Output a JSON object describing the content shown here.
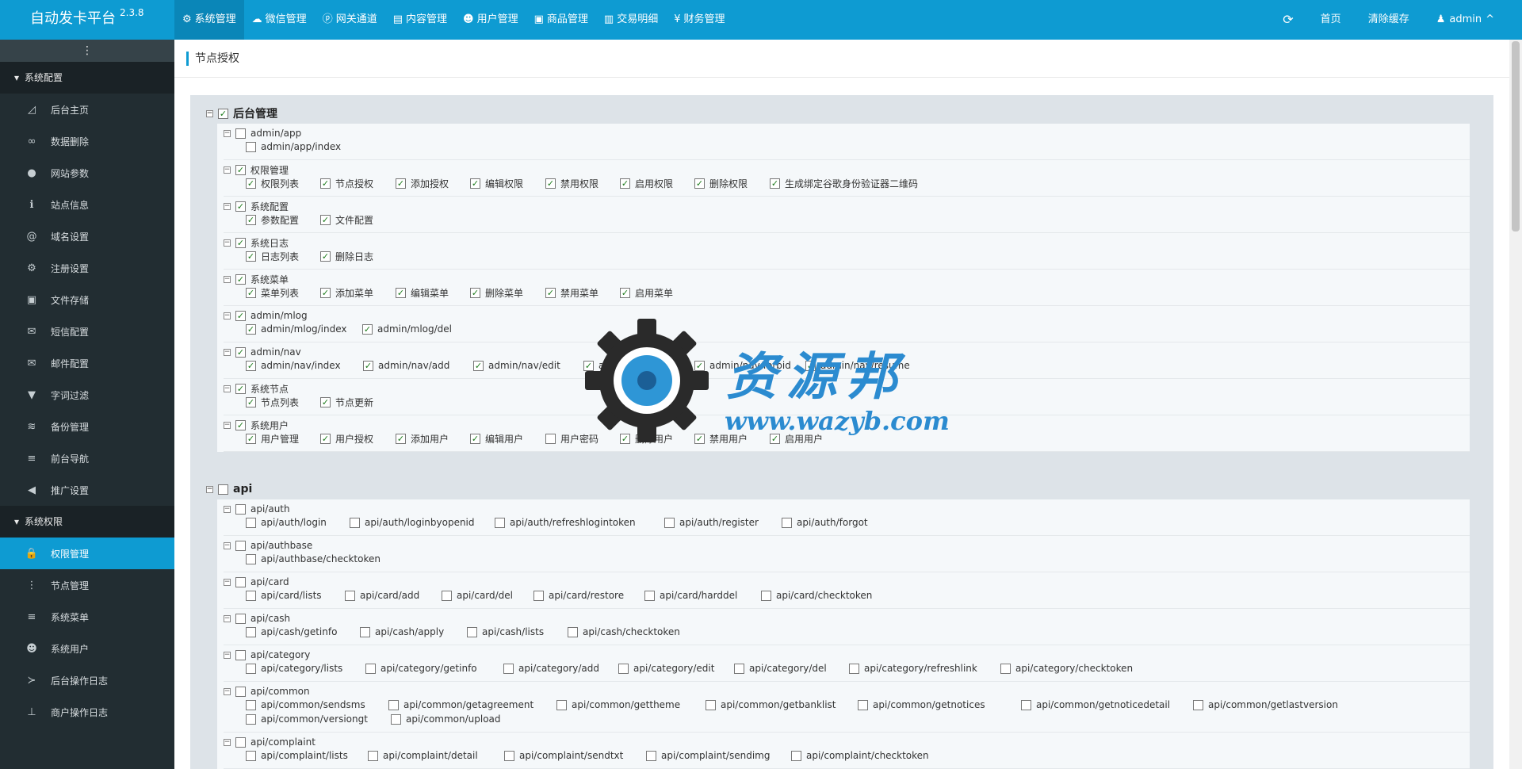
{
  "app": {
    "name": "自动发卡平台",
    "version": "2.3.8"
  },
  "topnav": [
    {
      "label": "系统管理",
      "icon": "gear-icon",
      "glyph": "⚙"
    },
    {
      "label": "微信管理",
      "icon": "wechat-icon",
      "glyph": "☁"
    },
    {
      "label": "网关通道",
      "icon": "gateway-icon",
      "glyph": "ⓟ"
    },
    {
      "label": "内容管理",
      "icon": "document-icon",
      "glyph": "▤"
    },
    {
      "label": "用户管理",
      "icon": "users-icon",
      "glyph": "☻"
    },
    {
      "label": "商品管理",
      "icon": "shopping-bag-icon",
      "glyph": "▣"
    },
    {
      "label": "交易明细",
      "icon": "bar-chart-icon",
      "glyph": "▥"
    },
    {
      "label": "财务管理",
      "icon": "finance-icon",
      "glyph": "¥"
    }
  ],
  "topright": {
    "refresh_glyph": "⟳",
    "home": "首页",
    "clear_cache": "清除缓存",
    "user": "admin",
    "user_glyph": "♟",
    "caret": "^"
  },
  "sidebar": {
    "toggle_glyph": "⋮",
    "groups": [
      {
        "label": "系统配置",
        "caret": "▾"
      },
      {
        "label": "系统权限",
        "caret": "▾"
      }
    ],
    "config_items": [
      {
        "label": "后台主页",
        "icon": "area-chart-icon",
        "glyph": "◿"
      },
      {
        "label": "数据删除",
        "icon": "link-icon",
        "glyph": "∞"
      },
      {
        "label": "网站参数",
        "icon": "apple-icon",
        "glyph": "●"
      },
      {
        "label": "站点信息",
        "icon": "info-icon",
        "glyph": "ℹ"
      },
      {
        "label": "域名设置",
        "icon": "at-icon",
        "glyph": "@"
      },
      {
        "label": "注册设置",
        "icon": "cog-icon",
        "glyph": "⚙"
      },
      {
        "label": "文件存储",
        "icon": "save-icon",
        "glyph": "▣"
      },
      {
        "label": "短信配置",
        "icon": "envelope-icon",
        "glyph": "✉"
      },
      {
        "label": "邮件配置",
        "icon": "envelope-o-icon",
        "glyph": "✉"
      },
      {
        "label": "字词过滤",
        "icon": "filter-icon",
        "glyph": "▼"
      },
      {
        "label": "备份管理",
        "icon": "database-icon",
        "glyph": "≋"
      },
      {
        "label": "前台导航",
        "icon": "bars-icon",
        "glyph": "≡"
      },
      {
        "label": "推广设置",
        "icon": "bullhorn-icon",
        "glyph": "◀"
      }
    ],
    "auth_items": [
      {
        "label": "权限管理",
        "icon": "lock-icon",
        "glyph": "🔒"
      },
      {
        "label": "节点管理",
        "icon": "ellipsis-vertical-icon",
        "glyph": "⋮"
      },
      {
        "label": "系统菜单",
        "icon": "bars-icon",
        "glyph": "≡"
      },
      {
        "label": "系统用户",
        "icon": "users-icon",
        "glyph": "☻"
      },
      {
        "label": "后台操作日志",
        "icon": "terminal-icon",
        "glyph": "≻"
      },
      {
        "label": "商户操作日志",
        "icon": "thumb-tack-icon",
        "glyph": "⊥"
      }
    ]
  },
  "page": {
    "title": "节点授权"
  },
  "modules": [
    {
      "label": "后台管理",
      "checked": true,
      "groups": [
        {
          "label": "admin/app",
          "checked": false,
          "items": [
            {
              "label": "admin/app/index",
              "checked": false
            }
          ]
        },
        {
          "label": "权限管理",
          "checked": true,
          "items": [
            {
              "label": "权限列表",
              "checked": true
            },
            {
              "label": "节点授权",
              "checked": true
            },
            {
              "label": "添加授权",
              "checked": true
            },
            {
              "label": "编辑权限",
              "checked": true
            },
            {
              "label": "禁用权限",
              "checked": true
            },
            {
              "label": "启用权限",
              "checked": true
            },
            {
              "label": "删除权限",
              "checked": true
            },
            {
              "label": "生成绑定谷歌身份验证器二维码",
              "checked": true
            }
          ]
        },
        {
          "label": "系统配置",
          "checked": true,
          "items": [
            {
              "label": "参数配置",
              "checked": true
            },
            {
              "label": "文件配置",
              "checked": true
            }
          ]
        },
        {
          "label": "系统日志",
          "checked": true,
          "items": [
            {
              "label": "日志列表",
              "checked": true
            },
            {
              "label": "删除日志",
              "checked": true
            }
          ]
        },
        {
          "label": "系统菜单",
          "checked": true,
          "items": [
            {
              "label": "菜单列表",
              "checked": true
            },
            {
              "label": "添加菜单",
              "checked": true
            },
            {
              "label": "编辑菜单",
              "checked": true
            },
            {
              "label": "删除菜单",
              "checked": true
            },
            {
              "label": "禁用菜单",
              "checked": true
            },
            {
              "label": "启用菜单",
              "checked": true
            }
          ]
        },
        {
          "label": "admin/mlog",
          "checked": true,
          "items": [
            {
              "label": "admin/mlog/index",
              "checked": true
            },
            {
              "label": "admin/mlog/del",
              "checked": true
            }
          ]
        },
        {
          "label": "admin/nav",
          "checked": true,
          "items": [
            {
              "label": "admin/nav/index",
              "checked": true
            },
            {
              "label": "admin/nav/add",
              "checked": true
            },
            {
              "label": "admin/nav/edit",
              "checked": true
            },
            {
              "label": "admin/nav/del",
              "checked": true
            },
            {
              "label": "admin/nav/forbid",
              "checked": true
            },
            {
              "label": "admin/nav/resume",
              "checked": true
            }
          ]
        },
        {
          "label": "系统节点",
          "checked": true,
          "items": [
            {
              "label": "节点列表",
              "checked": true
            },
            {
              "label": "节点更新",
              "checked": true
            }
          ]
        },
        {
          "label": "系统用户",
          "checked": true,
          "items": [
            {
              "label": "用户管理",
              "checked": true
            },
            {
              "label": "用户授权",
              "checked": true
            },
            {
              "label": "添加用户",
              "checked": true
            },
            {
              "label": "编辑用户",
              "checked": true
            },
            {
              "label": "用户密码",
              "checked": false
            },
            {
              "label": "删除用户",
              "checked": true
            },
            {
              "label": "禁用用户",
              "checked": true
            },
            {
              "label": "启用用户",
              "checked": true
            }
          ]
        }
      ]
    },
    {
      "label": "api",
      "checked": false,
      "groups": [
        {
          "label": "api/auth",
          "checked": false,
          "items": [
            {
              "label": "api/auth/login",
              "checked": false
            },
            {
              "label": "api/auth/loginbyopenid",
              "checked": false
            },
            {
              "label": "api/auth/refreshlogintoken",
              "checked": false
            },
            {
              "label": "api/auth/register",
              "checked": false
            },
            {
              "label": "api/auth/forgot",
              "checked": false
            }
          ]
        },
        {
          "label": "api/authbase",
          "checked": false,
          "items": [
            {
              "label": "api/authbase/checktoken",
              "checked": false
            }
          ]
        },
        {
          "label": "api/card",
          "checked": false,
          "items": [
            {
              "label": "api/card/lists",
              "checked": false
            },
            {
              "label": "api/card/add",
              "checked": false
            },
            {
              "label": "api/card/del",
              "checked": false
            },
            {
              "label": "api/card/restore",
              "checked": false
            },
            {
              "label": "api/card/harddel",
              "checked": false
            },
            {
              "label": "api/card/checktoken",
              "checked": false
            }
          ]
        },
        {
          "label": "api/cash",
          "checked": false,
          "items": [
            {
              "label": "api/cash/getinfo",
              "checked": false
            },
            {
              "label": "api/cash/apply",
              "checked": false
            },
            {
              "label": "api/cash/lists",
              "checked": false
            },
            {
              "label": "api/cash/checktoken",
              "checked": false
            }
          ]
        },
        {
          "label": "api/category",
          "checked": false,
          "items": [
            {
              "label": "api/category/lists",
              "checked": false
            },
            {
              "label": "api/category/getinfo",
              "checked": false
            },
            {
              "label": "api/category/add",
              "checked": false
            },
            {
              "label": "api/category/edit",
              "checked": false
            },
            {
              "label": "api/category/del",
              "checked": false
            },
            {
              "label": "api/category/refreshlink",
              "checked": false
            },
            {
              "label": "api/category/checktoken",
              "checked": false
            }
          ]
        },
        {
          "label": "api/common",
          "checked": false,
          "items": [
            {
              "label": "api/common/sendsms",
              "checked": false
            },
            {
              "label": "api/common/getagreement",
              "checked": false
            },
            {
              "label": "api/common/gettheme",
              "checked": false
            },
            {
              "label": "api/common/getbanklist",
              "checked": false
            },
            {
              "label": "api/common/getnotices",
              "checked": false
            },
            {
              "label": "api/common/getnoticedetail",
              "checked": false
            },
            {
              "label": "api/common/getlastversion",
              "checked": false
            },
            {
              "label": "api/common/versiongt",
              "checked": false
            },
            {
              "label": "api/common/upload",
              "checked": false
            }
          ]
        },
        {
          "label": "api/complaint",
          "checked": false,
          "items": [
            {
              "label": "api/complaint/lists",
              "checked": false
            },
            {
              "label": "api/complaint/detail",
              "checked": false
            },
            {
              "label": "api/complaint/sendtxt",
              "checked": false
            },
            {
              "label": "api/complaint/sendimg",
              "checked": false
            },
            {
              "label": "api/complaint/checktoken",
              "checked": false
            }
          ]
        }
      ]
    }
  ],
  "watermark": {
    "title": "资源邦",
    "url": "www.wazyb.com"
  }
}
